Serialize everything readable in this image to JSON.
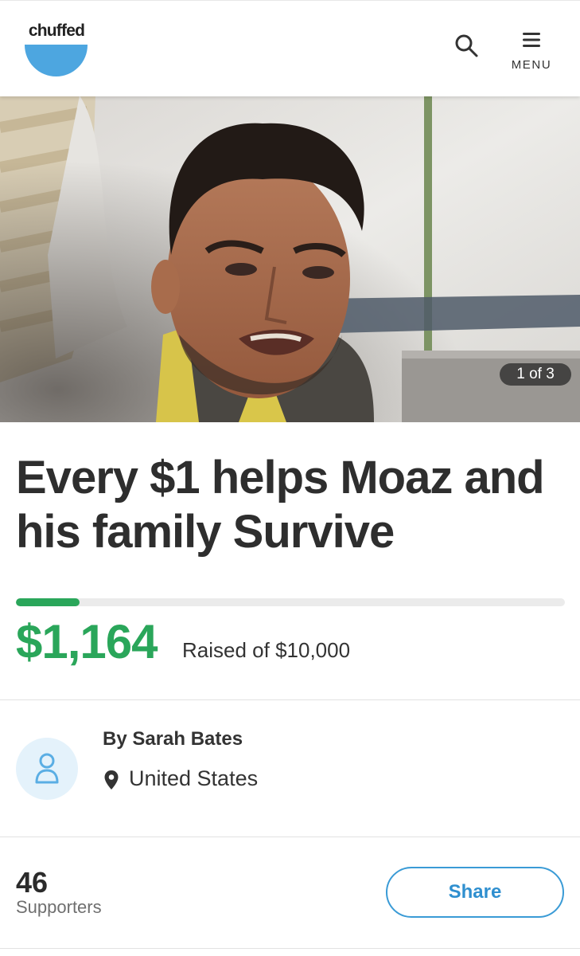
{
  "header": {
    "logo_text": "chuffed",
    "menu_label": "MENU"
  },
  "hero": {
    "counter": "1 of 3"
  },
  "campaign": {
    "title": "Every $1 helps Moaz and his family Survive",
    "amount_raised": "$1,164",
    "goal_text": "Raised of $10,000",
    "progress_fraction": 0.1164
  },
  "organiser": {
    "by_line": "By Sarah Bates",
    "location": "United States"
  },
  "supporters": {
    "count": "46",
    "label": "Supporters",
    "share_label": "Share"
  },
  "colors": {
    "brand_blue": "#4da6e0",
    "progress_green": "#2aa65a",
    "share_blue": "#2f8fcf"
  }
}
